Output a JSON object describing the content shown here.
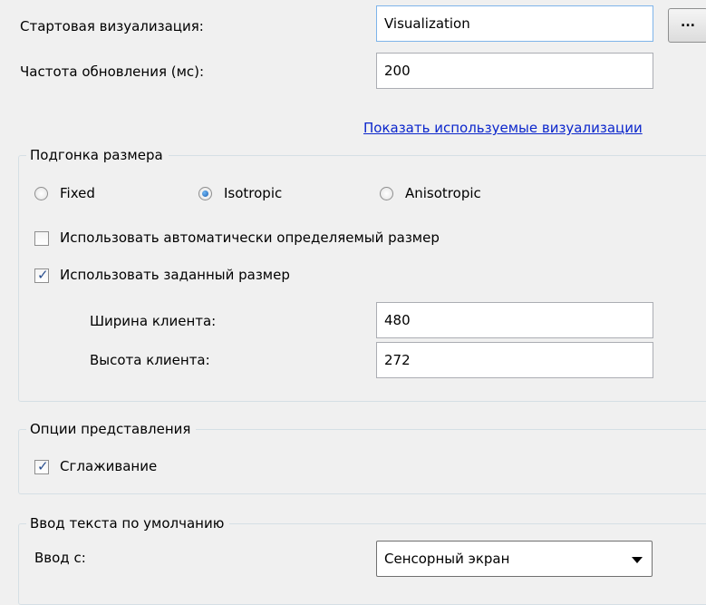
{
  "general": {
    "start_vis_label": "Стартовая визуализация:",
    "start_vis_value": "Visualization",
    "browse_label": "...",
    "update_rate_label": "Частота обновления (мс):",
    "update_rate_value": "200",
    "show_used_link": "Показать используемые визуализации"
  },
  "scaling": {
    "legend": "Подгонка размера",
    "radio_fixed": "Fixed",
    "radio_isotropic": "Isotropic",
    "radio_anisotropic": "Anisotropic",
    "selected": "Isotropic",
    "auto_size_label": "Использовать автоматически определяемый размер",
    "auto_size_checked": false,
    "custom_size_label": "Использовать заданный размер",
    "custom_size_checked": true,
    "width_label": "Ширина клиента:",
    "width_value": "480",
    "height_label": "Высота клиента:",
    "height_value": "272"
  },
  "presentation": {
    "legend": "Опции представления",
    "antialias_label": "Сглаживание",
    "antialias_checked": true
  },
  "text_input": {
    "legend": "Ввод текста по умолчанию",
    "input_from_label": "Ввод с:",
    "input_from_value": "Сенсорный экран"
  }
}
